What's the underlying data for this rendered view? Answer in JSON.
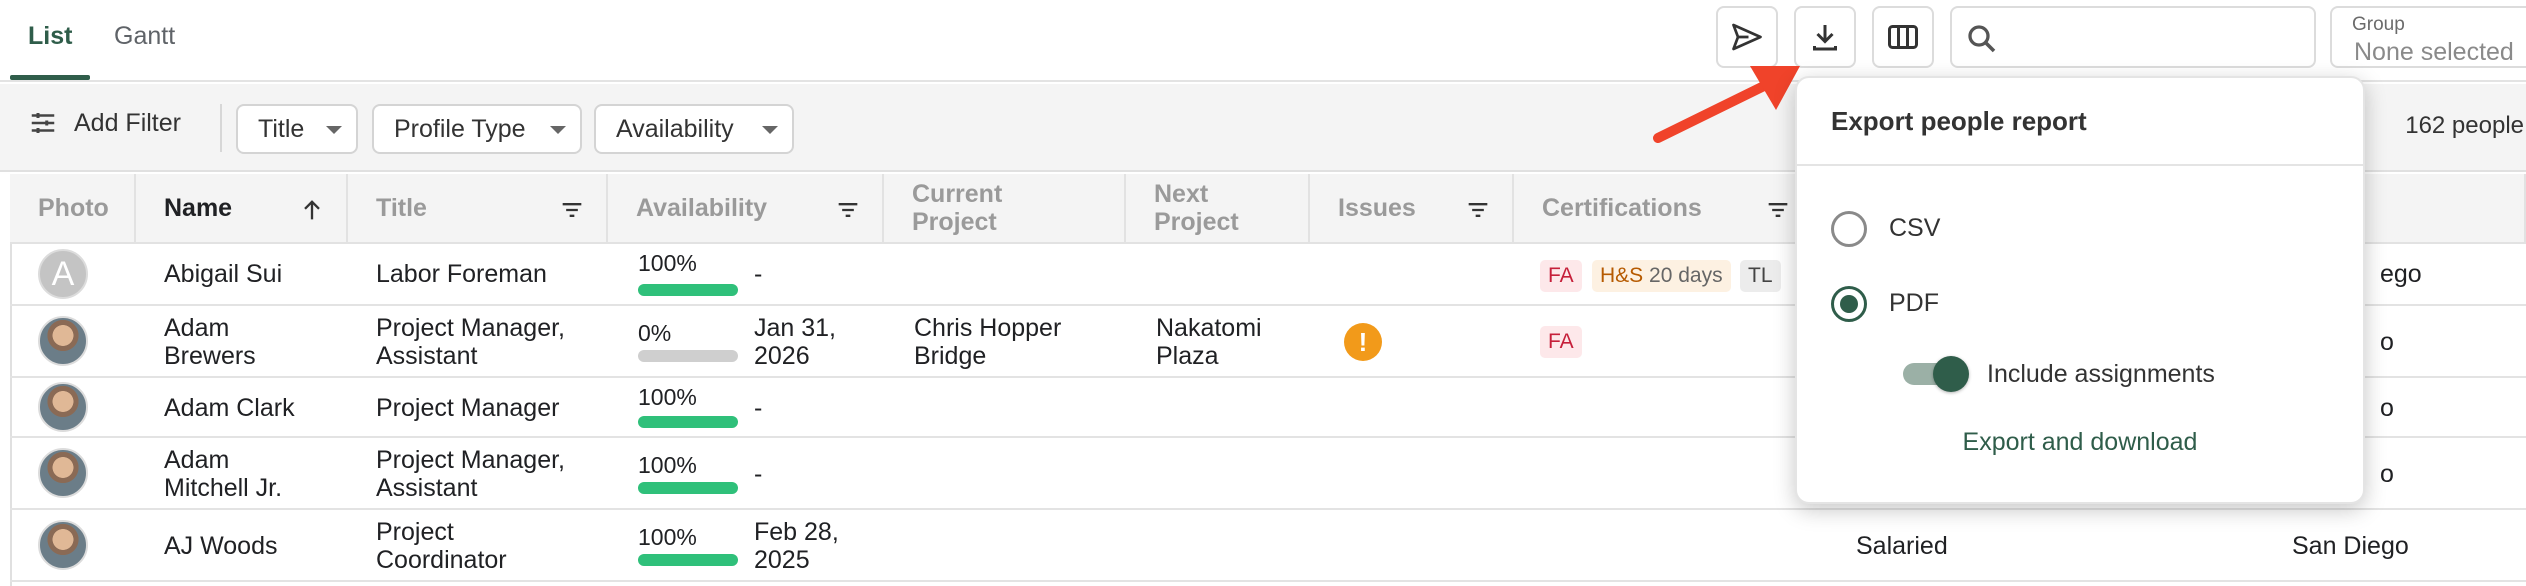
{
  "tabs": [
    {
      "label": "List",
      "active": true
    },
    {
      "label": "Gantt",
      "active": false
    }
  ],
  "toolbar": {
    "icons": [
      "send-icon",
      "download-icon",
      "columns-icon",
      "search-icon"
    ],
    "search_placeholder": "",
    "group_label": "Group",
    "group_value": "None selected"
  },
  "filters": {
    "add_filter_label": "Add Filter",
    "chips": [
      "Title",
      "Profile Type",
      "Availability"
    ],
    "count_text": "162 people"
  },
  "table": {
    "columns": [
      "Photo",
      "Name",
      "Title",
      "Availability",
      "Current Project",
      "Next Project",
      "Issues",
      "Certifications"
    ],
    "rows": [
      {
        "avatar": "A",
        "name": "Abigail Sui",
        "title": "Labor Foreman",
        "availability_pct": "100%",
        "availability_fraction": 1.0,
        "available_from": "-",
        "current_project": "",
        "next_project": "",
        "issue": "",
        "certifications": [
          {
            "label": "FA",
            "style": "red"
          },
          {
            "label": "H&S",
            "suffix": "20 days",
            "style": "orange"
          },
          {
            "label": "TL",
            "style": "gray"
          }
        ],
        "right_text": "ego",
        "right_col": "",
        "right_col2": ""
      },
      {
        "avatar": "",
        "name": "Adam Brewers",
        "title": "Project Manager, Assistant",
        "availability_pct": "0%",
        "availability_fraction": 0.0,
        "available_from": "Jan 31, 2026",
        "current_project": "Chris Hopper Bridge",
        "next_project": "Nakatomi Plaza",
        "issue": "!",
        "certifications": [
          {
            "label": "FA",
            "style": "red"
          }
        ],
        "right_text": "o",
        "right_col": "",
        "right_col2": ""
      },
      {
        "avatar": "",
        "name": "Adam Clark",
        "title": "Project Manager",
        "availability_pct": "100%",
        "availability_fraction": 1.0,
        "available_from": "-",
        "current_project": "",
        "next_project": "",
        "issue": "",
        "certifications": [],
        "right_text": "o",
        "right_col": "",
        "right_col2": ""
      },
      {
        "avatar": "",
        "name": "Adam Mitchell Jr.",
        "title": "Project Manager, Assistant",
        "availability_pct": "100%",
        "availability_fraction": 1.0,
        "available_from": "-",
        "current_project": "",
        "next_project": "",
        "issue": "",
        "certifications": [],
        "right_text": "o",
        "right_col": "",
        "right_col2": ""
      },
      {
        "avatar": "",
        "name": "AJ Woods",
        "title": "Project Coordinator",
        "availability_pct": "100%",
        "availability_fraction": 1.0,
        "available_from": "Feb 28, 2025",
        "current_project": "",
        "next_project": "",
        "issue": "",
        "certifications": [],
        "right_text": "",
        "right_col": "Salaried",
        "right_col2": "San Diego"
      }
    ]
  },
  "popover": {
    "title": "Export people report",
    "options": [
      {
        "label": "CSV",
        "selected": false
      },
      {
        "label": "PDF",
        "selected": true
      }
    ],
    "toggle_label": "Include assignments",
    "toggle_on": true,
    "action_label": "Export and download"
  },
  "colors": {
    "accent": "#2f5d4a",
    "bar_fill": "#2fc07a",
    "arrow": "#f0432a"
  }
}
